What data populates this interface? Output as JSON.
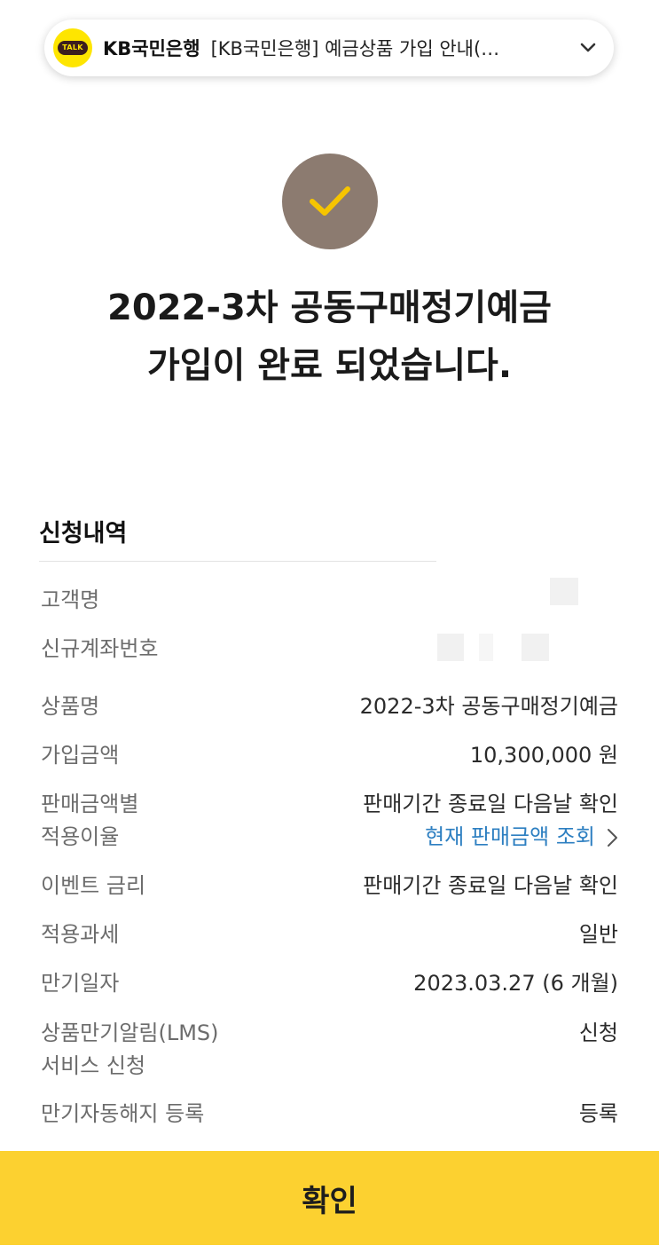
{
  "notification": {
    "icon": "kakaotalk-icon",
    "badge_text": "TALK",
    "sender": "KB국민은행",
    "subject": "[KB국민은행] 예금상품 가입 안내(…"
  },
  "result": {
    "icon": "checkmark-icon",
    "line1": "2022-3차 공동구매정기예금",
    "line2": "가입이 완료 되었습니다."
  },
  "details": {
    "title": "신청내역",
    "customer_name_label": "고객명",
    "account_label": "신규계좌번호",
    "product_label": "상품명",
    "product_value": "2022-3차 공동구매정기예금",
    "amount_label": "가입금액",
    "amount_value": "10,300,000 원",
    "rate_label_1": "판매금액별",
    "rate_label_2": "적용이율",
    "rate_value": "판매기간 종료일 다음날 확인",
    "rate_link": "현재 판매금액 조회",
    "event_label": "이벤트 금리",
    "event_value": "판매기간 종료일 다음날 확인",
    "tax_label": "적용과세",
    "tax_value": "일반",
    "maturity_label": "만기일자",
    "maturity_value": "2023.03.27 (6 개월)",
    "lms_label_1": "상품만기알림(LMS)",
    "lms_label_2": "서비스 신청",
    "lms_value": "신청",
    "auto_label": "만기자동해지 등록",
    "auto_value": "등록"
  },
  "confirm_label": "확인",
  "colors": {
    "brand_yellow": "#fcd130",
    "check_circle": "#8c7b70",
    "check_mark": "#f6c500",
    "link": "#2d7fc1"
  }
}
